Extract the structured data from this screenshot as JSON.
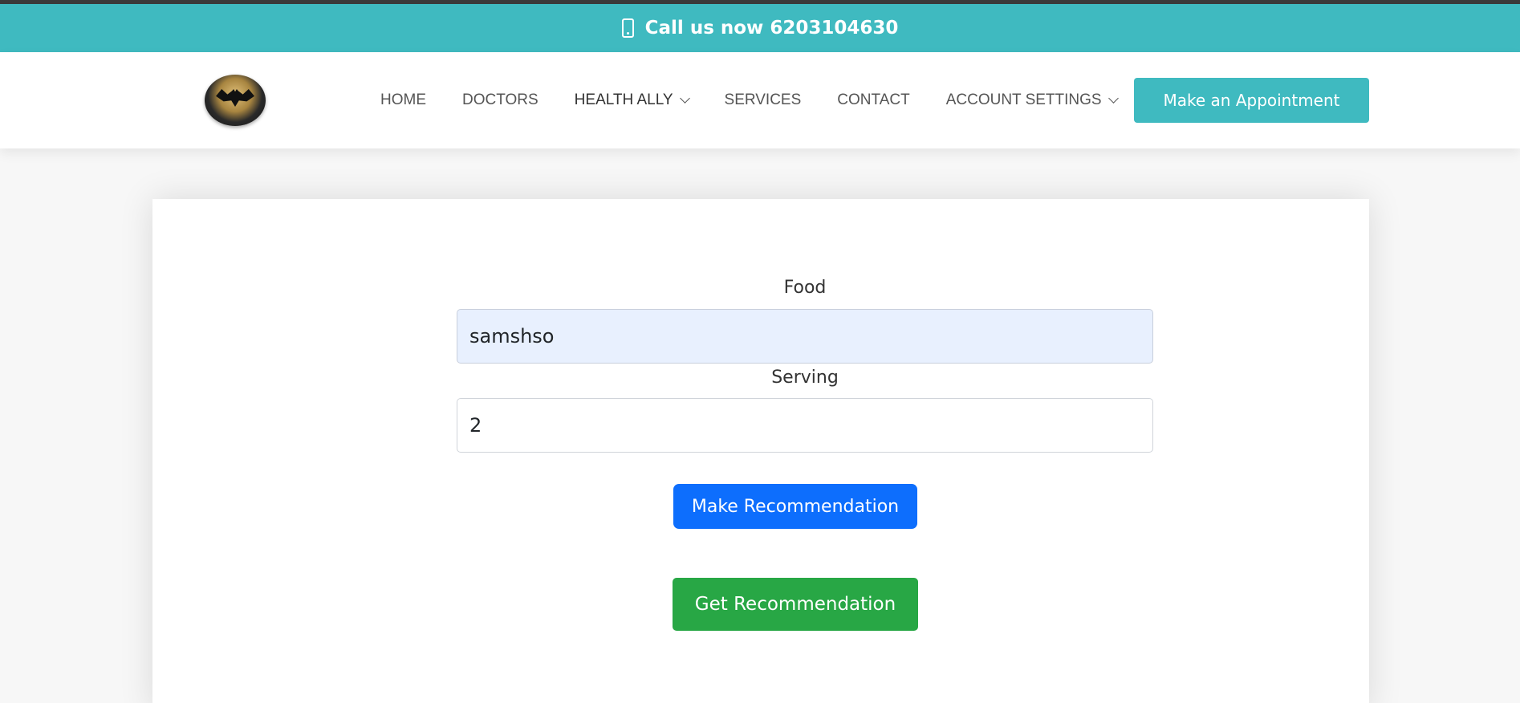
{
  "topbar": {
    "phone_icon": "mobile-phone-icon",
    "call_text": "Call us now 6203104630"
  },
  "navbar": {
    "logo": "batman-logo",
    "items": [
      {
        "label": "HOME"
      },
      {
        "label": "DOCTORS"
      },
      {
        "label": "HEALTH ALLY",
        "dropdown": true
      },
      {
        "label": "SERVICES"
      },
      {
        "label": "CONTACT"
      },
      {
        "label": "ACCOUNT SETTINGS",
        "dropdown": true
      }
    ],
    "appointment_button": "Make an Appointment"
  },
  "form": {
    "food_label": "Food",
    "food_value": "samshso",
    "serving_label": "Serving",
    "serving_value": "2",
    "make_button": "Make Recommendation",
    "get_button": "Get Recommendation"
  },
  "colors": {
    "brand_teal": "#3fbac0",
    "primary_blue": "#0d6efd",
    "success_green": "#28a745"
  }
}
